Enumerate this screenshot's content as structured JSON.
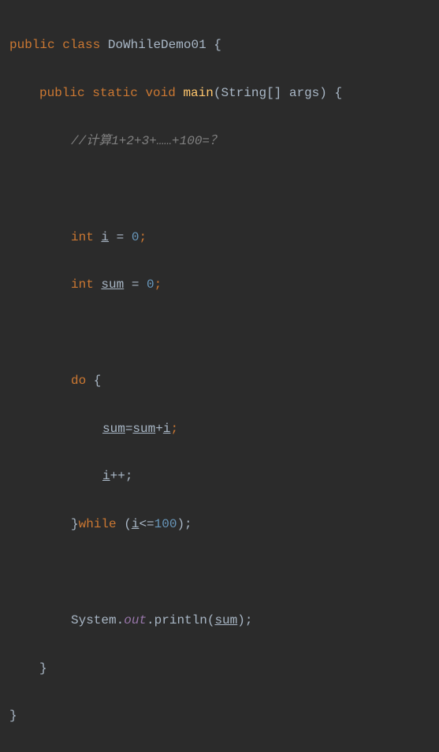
{
  "code": {
    "l1": {
      "kw_public": "public",
      "kw_class": "class",
      "classname": "DoWhileDemo01",
      "brace": " {"
    },
    "l2": {
      "kw_public": "public",
      "kw_static": "static",
      "kw_void": "void",
      "method": "main",
      "params": "(String[] args) {"
    },
    "l3": {
      "comment": "//计算1+2+3+……+100=？"
    },
    "l4": {
      "kw_int": "int",
      "var": "i",
      "eq": " = ",
      "val": "0",
      "semi": ";"
    },
    "l5": {
      "kw_int": "int",
      "var": "sum",
      "eq": " = ",
      "val": "0",
      "semi": ";"
    },
    "l6": {
      "kw_do": "do",
      "brace": " {"
    },
    "l7": {
      "var1": "sum",
      "eq": "=",
      "var2": "sum",
      "plus": "+",
      "var3": "i",
      "semi": ";"
    },
    "l8": {
      "var": "i",
      "inc": "++;"
    },
    "l9": {
      "brace": "}",
      "kw_while": "while",
      "open": " (",
      "var": "i",
      "cond": "<=",
      "num": "100",
      "close": ");"
    },
    "l10": {
      "obj": "System.",
      "field": "out",
      "method": ".println(",
      "var": "sum",
      "close": ");"
    },
    "l11": {
      "brace": "}"
    },
    "l12": {
      "brace": "}"
    }
  }
}
